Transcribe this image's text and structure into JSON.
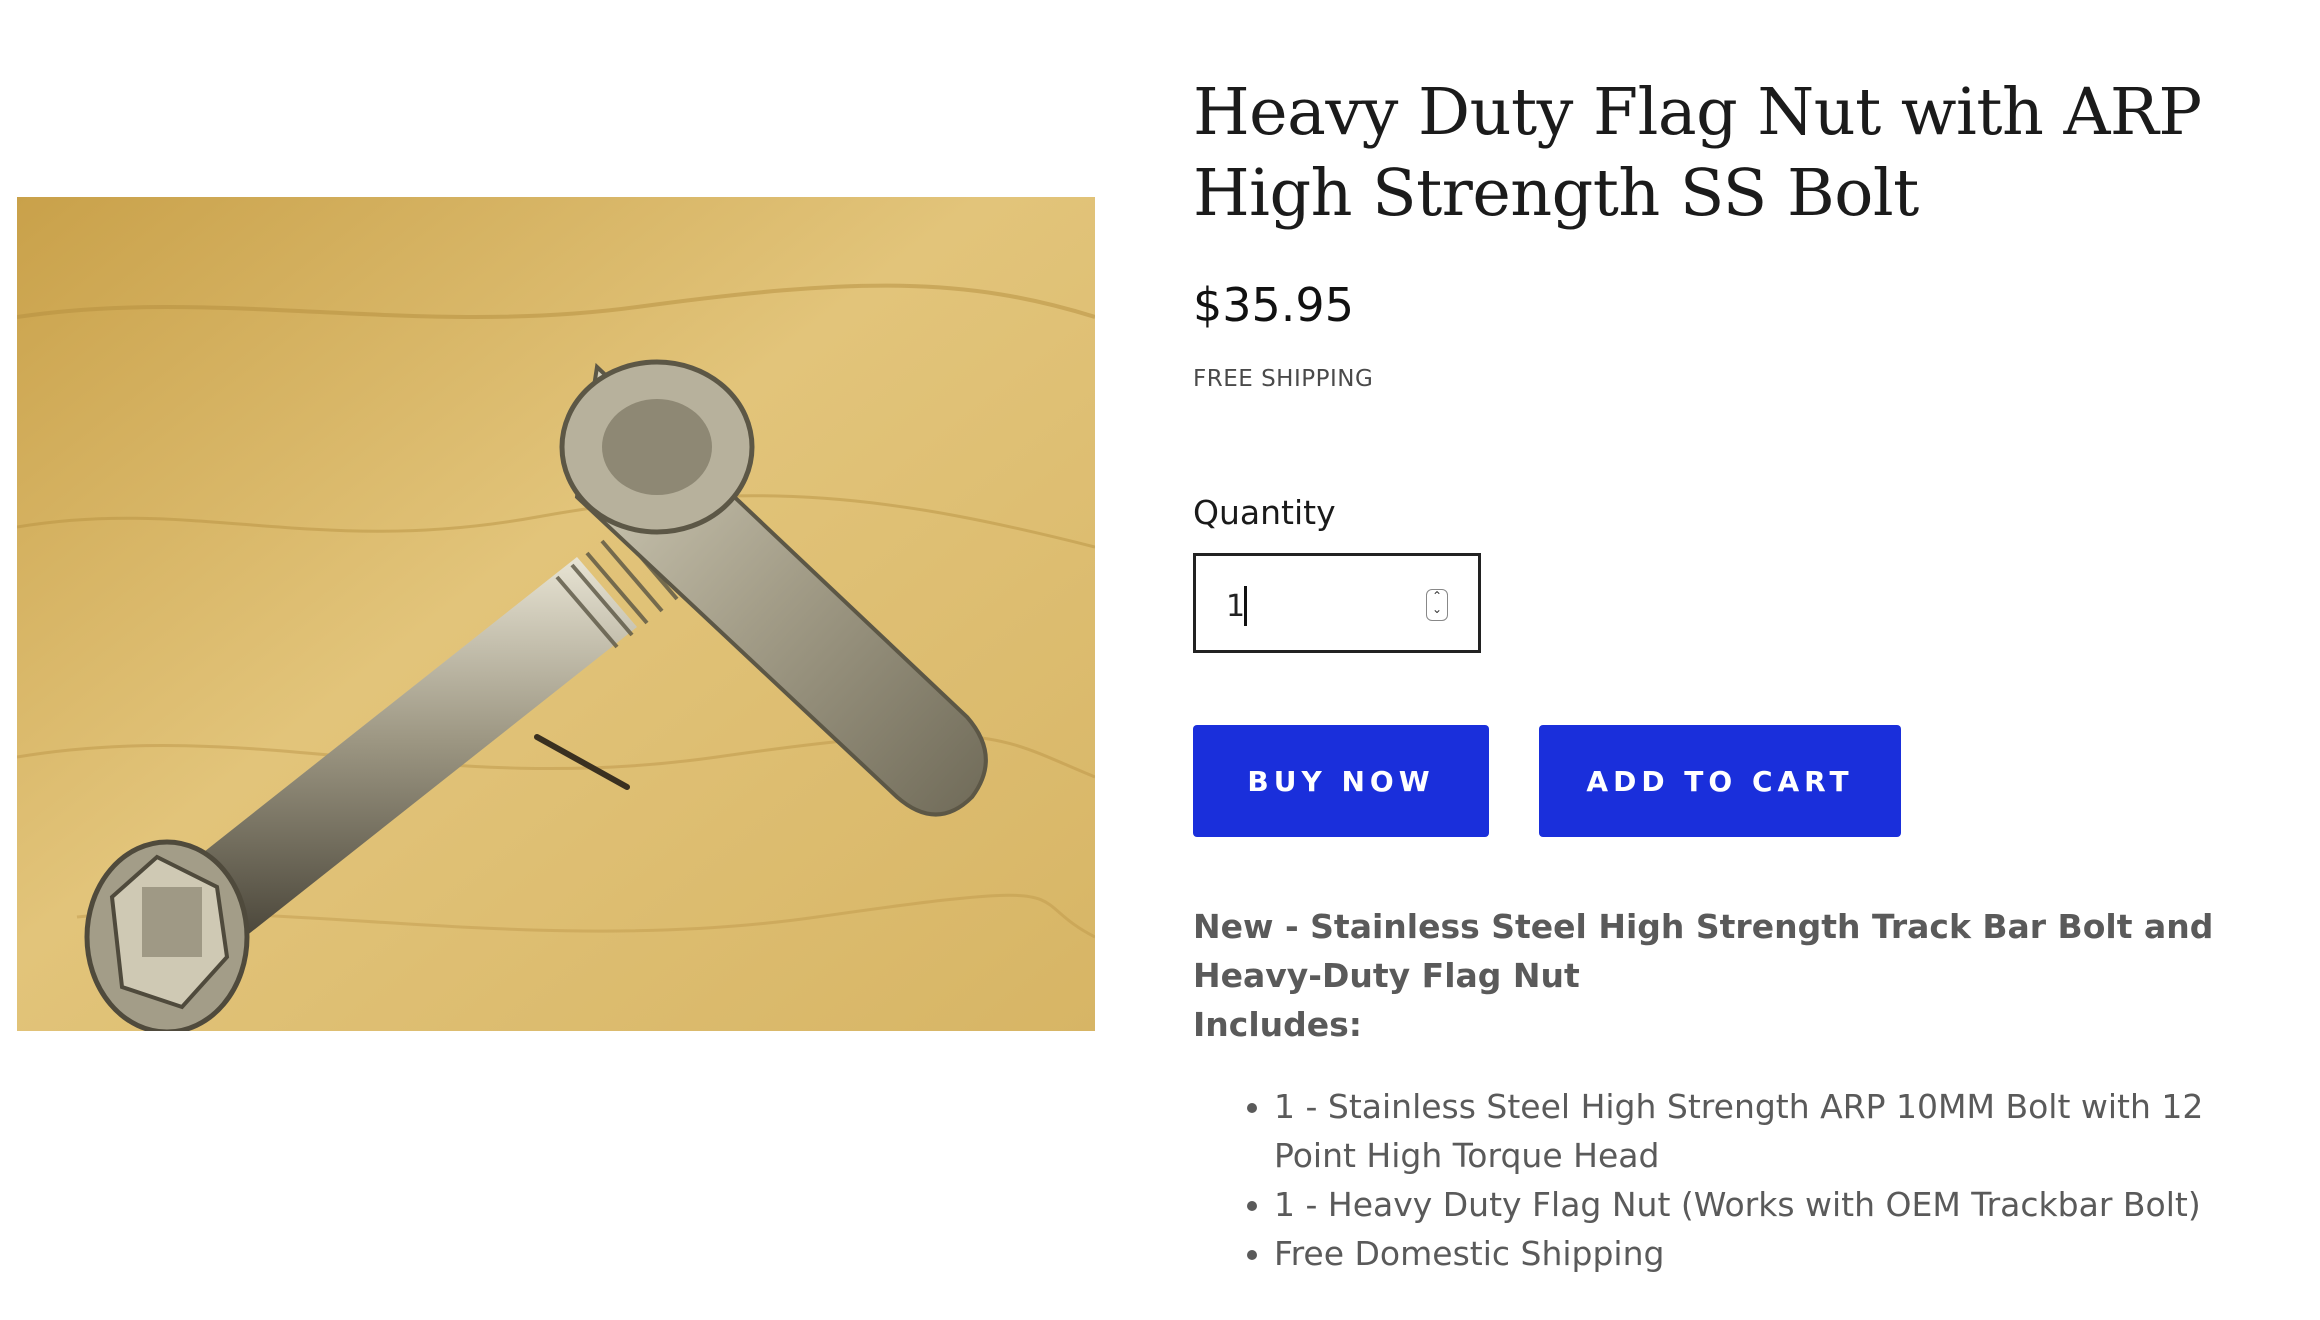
{
  "product": {
    "title": "Heavy Duty Flag Nut with ARP High Strength SS Bolt",
    "price": "$35.95",
    "shipping_note": "FREE SHIPPING",
    "image_alt": "Flag nut with ARP bolt on wooden surface"
  },
  "quantity": {
    "label": "Quantity",
    "value": "1",
    "stepper_icon": "up-down-chevron-icon"
  },
  "actions": {
    "buy_now_label": "BUY NOW",
    "add_to_cart_label": "ADD TO CART",
    "button_color": "#1a2fdb"
  },
  "description": {
    "heading_line1": "New - Stainless Steel High Strength Track Bar Bolt and Heavy-Duty Flag Nut",
    "heading_line2": "Includes:",
    "items": [
      "1 - Stainless Steel High Strength ARP 10MM Bolt with 12 Point High Torque Head",
      "1 - Heavy Duty Flag Nut (Works with OEM Trackbar Bolt)",
      "Free Domestic Shipping"
    ]
  }
}
